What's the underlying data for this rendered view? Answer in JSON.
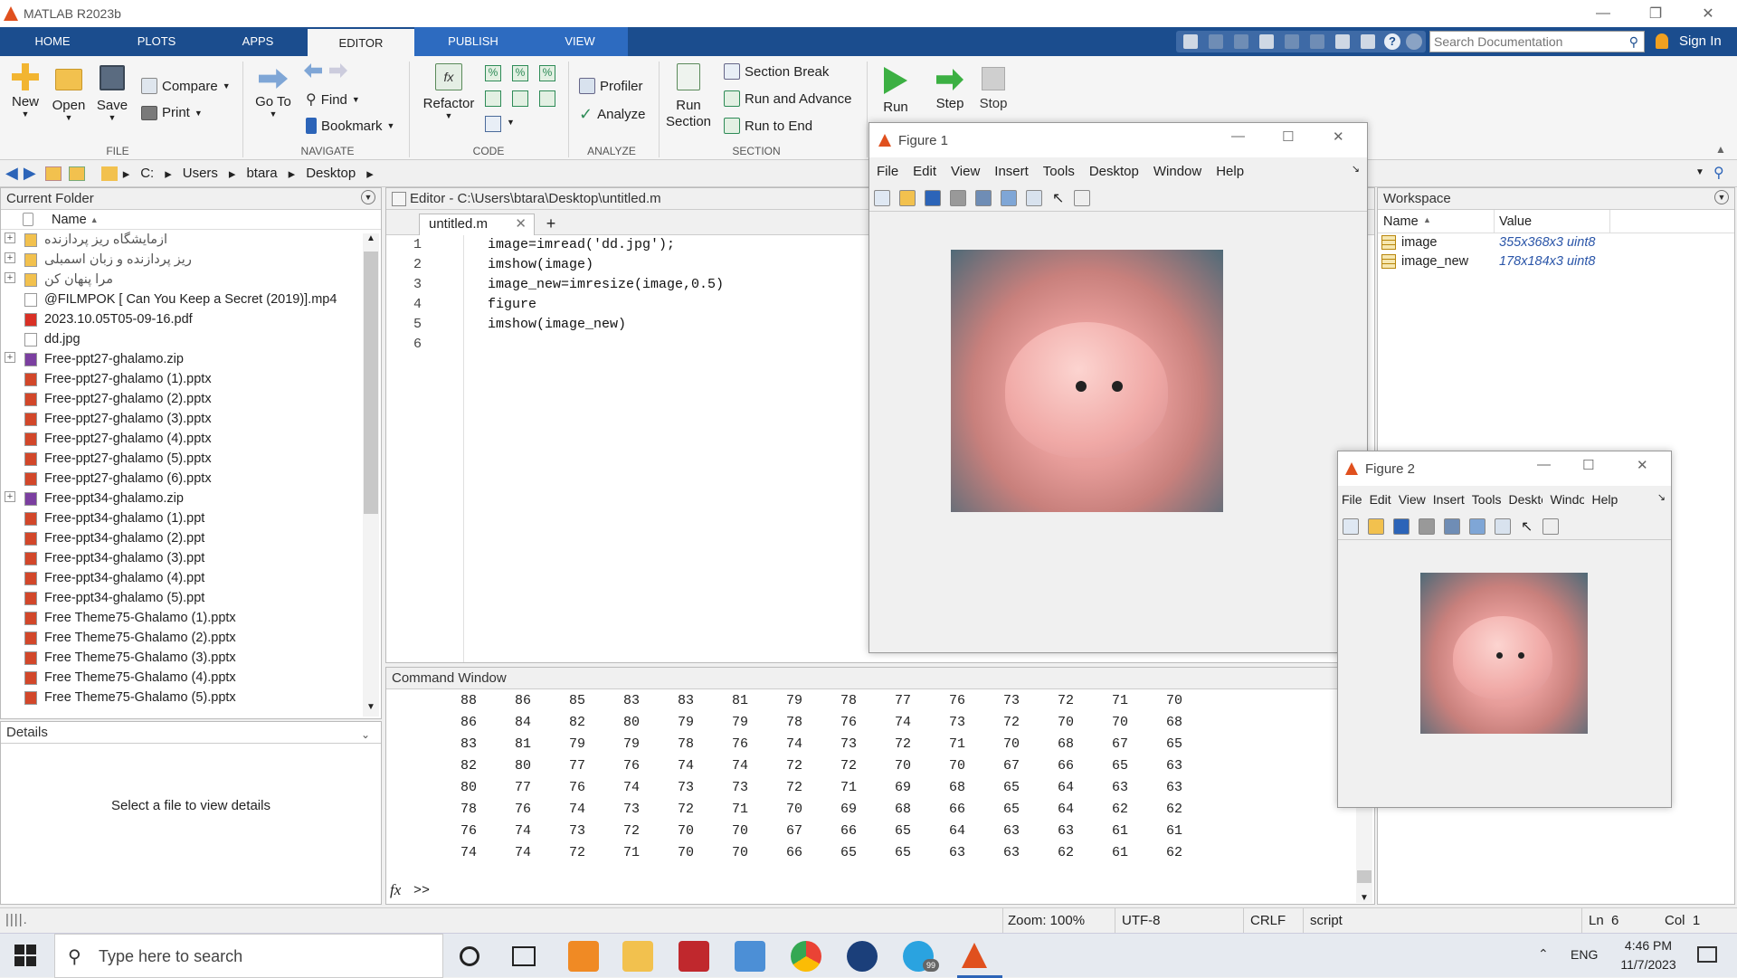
{
  "app": {
    "title": "MATLAB R2023b"
  },
  "ribbon_tabs": [
    "HOME",
    "PLOTS",
    "APPS",
    "EDITOR",
    "PUBLISH",
    "VIEW"
  ],
  "active_tab": "EDITOR",
  "search": {
    "placeholder": "Search Documentation"
  },
  "signin": "Sign In",
  "ribbon": {
    "new": "New",
    "open": "Open",
    "save": "Save",
    "compare": "Compare",
    "print": "Print",
    "goto": "Go To",
    "find": "Find",
    "bookmark": "Bookmark",
    "refactor": "Refactor",
    "profiler": "Profiler",
    "analyze": "Analyze",
    "run_section": "Run\nSection",
    "section_break": "Section Break",
    "run_advance": "Run and Advance",
    "run_to_end": "Run to End",
    "run": "Run",
    "step": "Step",
    "stop": "Stop",
    "groups": {
      "file": "FILE",
      "navigate": "NAVIGATE",
      "code": "CODE",
      "analyze": "ANALYZE",
      "section": "SECTION"
    }
  },
  "address": {
    "crumbs": [
      "C:",
      "Users",
      "btara",
      "Desktop"
    ]
  },
  "current_folder": {
    "title": "Current Folder",
    "col_name": "Name",
    "items": [
      {
        "name": "ازمایشگاه ریز پردازنده",
        "type": "folder",
        "expand": true
      },
      {
        "name": "ریز پردازنده و زبان اسمبلی",
        "type": "folder",
        "expand": true
      },
      {
        "name": "مرا پنهان کن",
        "type": "folder",
        "expand": true
      },
      {
        "name": "@FILMPOK [ Can You Keep a Secret (2019)].mp4",
        "type": "file",
        "expand": false
      },
      {
        "name": "2023.10.05T05-09-16.pdf",
        "type": "pdf",
        "expand": false
      },
      {
        "name": "dd.jpg",
        "type": "file",
        "expand": false
      },
      {
        "name": "Free-ppt27-ghalamo.zip",
        "type": "zip",
        "expand": true
      },
      {
        "name": "Free-ppt27-ghalamo (1).pptx",
        "type": "ppt",
        "expand": false
      },
      {
        "name": "Free-ppt27-ghalamo (2).pptx",
        "type": "ppt",
        "expand": false
      },
      {
        "name": "Free-ppt27-ghalamo (3).pptx",
        "type": "ppt",
        "expand": false
      },
      {
        "name": "Free-ppt27-ghalamo (4).pptx",
        "type": "ppt",
        "expand": false
      },
      {
        "name": "Free-ppt27-ghalamo (5).pptx",
        "type": "ppt",
        "expand": false
      },
      {
        "name": "Free-ppt27-ghalamo (6).pptx",
        "type": "ppt",
        "expand": false
      },
      {
        "name": "Free-ppt34-ghalamo.zip",
        "type": "zip",
        "expand": true
      },
      {
        "name": "Free-ppt34-ghalamo (1).ppt",
        "type": "ppt",
        "expand": false
      },
      {
        "name": "Free-ppt34-ghalamo (2).ppt",
        "type": "ppt",
        "expand": false
      },
      {
        "name": "Free-ppt34-ghalamo (3).ppt",
        "type": "ppt",
        "expand": false
      },
      {
        "name": "Free-ppt34-ghalamo (4).ppt",
        "type": "ppt",
        "expand": false
      },
      {
        "name": "Free-ppt34-ghalamo (5).ppt",
        "type": "ppt",
        "expand": false
      },
      {
        "name": "Free Theme75-Ghalamo (1).pptx",
        "type": "ppt",
        "expand": false
      },
      {
        "name": "Free Theme75-Ghalamo (2).pptx",
        "type": "ppt",
        "expand": false
      },
      {
        "name": "Free Theme75-Ghalamo (3).pptx",
        "type": "ppt",
        "expand": false
      },
      {
        "name": "Free Theme75-Ghalamo (4).pptx",
        "type": "ppt",
        "expand": false
      },
      {
        "name": "Free Theme75-Ghalamo (5).pptx",
        "type": "ppt",
        "expand": false
      }
    ]
  },
  "details": {
    "title": "Details",
    "empty": "Select a file to view details"
  },
  "editor": {
    "title": "Editor - C:\\Users\\btara\\Desktop\\untitled.m",
    "tab": "untitled.m",
    "lines": [
      {
        "n": "1",
        "code": "image=imread('dd.jpg');"
      },
      {
        "n": "2",
        "code": "imshow(image)"
      },
      {
        "n": "3",
        "code": "image_new=imresize(image,0.5)"
      },
      {
        "n": "4",
        "code": "figure"
      },
      {
        "n": "5",
        "code": "imshow(image_new)"
      },
      {
        "n": "6",
        "code": ""
      }
    ]
  },
  "command_window": {
    "title": "Command Window",
    "prompt": ">>",
    "rows": [
      [
        "88",
        "86",
        "85",
        "83",
        "83",
        "81",
        "79",
        "78",
        "77",
        "76",
        "73",
        "72",
        "71",
        "70"
      ],
      [
        "86",
        "84",
        "82",
        "80",
        "79",
        "79",
        "78",
        "76",
        "74",
        "73",
        "72",
        "70",
        "70",
        "68"
      ],
      [
        "83",
        "81",
        "79",
        "79",
        "78",
        "76",
        "74",
        "73",
        "72",
        "71",
        "70",
        "68",
        "67",
        "65"
      ],
      [
        "82",
        "80",
        "77",
        "76",
        "74",
        "74",
        "72",
        "72",
        "70",
        "70",
        "67",
        "66",
        "65",
        "63"
      ],
      [
        "80",
        "77",
        "76",
        "74",
        "73",
        "73",
        "72",
        "71",
        "69",
        "68",
        "65",
        "64",
        "63",
        "63"
      ],
      [
        "78",
        "76",
        "74",
        "73",
        "72",
        "71",
        "70",
        "69",
        "68",
        "66",
        "65",
        "64",
        "62",
        "62"
      ],
      [
        "76",
        "74",
        "73",
        "72",
        "70",
        "70",
        "67",
        "66",
        "65",
        "64",
        "63",
        "63",
        "61",
        "61"
      ],
      [
        "74",
        "74",
        "72",
        "71",
        "70",
        "70",
        "66",
        "65",
        "65",
        "63",
        "63",
        "62",
        "61",
        "62"
      ]
    ]
  },
  "workspace": {
    "title": "Workspace",
    "col_name": "Name",
    "col_value": "Value",
    "vars": [
      {
        "name": "image",
        "value": "355x368x3 uint8"
      },
      {
        "name": "image_new",
        "value": "178x184x3 uint8"
      }
    ]
  },
  "figure1": {
    "title": "Figure 1",
    "menu": [
      "File",
      "Edit",
      "View",
      "Insert",
      "Tools",
      "Desktop",
      "Window",
      "Help"
    ]
  },
  "figure2": {
    "title": "Figure 2",
    "menu": [
      "File",
      "Edit",
      "View",
      "Insert",
      "Tools",
      "Desktop",
      "Window",
      "Help"
    ]
  },
  "status": {
    "zoom": "Zoom: 100%",
    "encoding": "UTF-8",
    "eol": "CRLF",
    "type": "script",
    "ln": "Ln  6",
    "col": "Col  1"
  },
  "taskbar": {
    "search_placeholder": "Type here to search",
    "lang": "ENG",
    "time": "4:46 PM",
    "date": "11/7/2023",
    "telegram_badge": "99"
  }
}
